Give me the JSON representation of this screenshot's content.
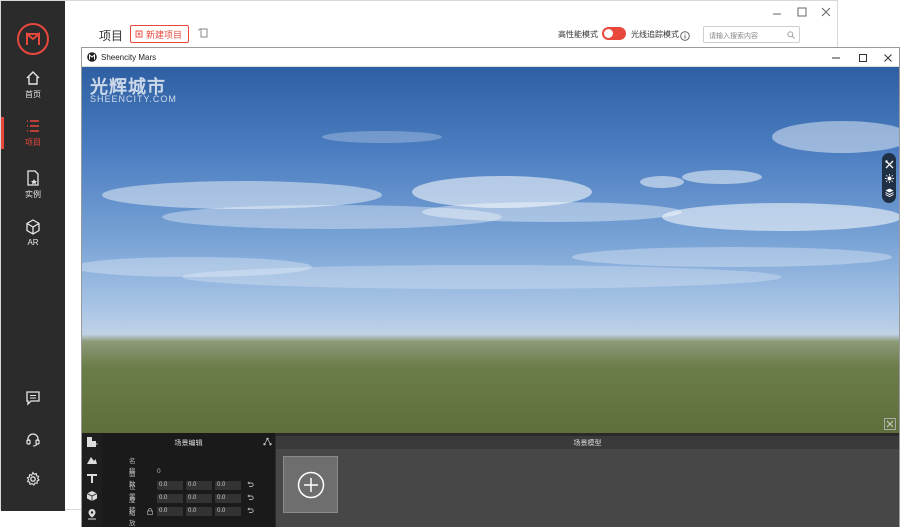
{
  "bg_app": {
    "header_title": "项目",
    "new_project_label": "新建项目",
    "perf_mode_label": "高性能模式",
    "ray_trace_label": "光线追踪模式",
    "search_placeholder": "请输入搜索内容",
    "accent": "#e8473c",
    "sidebar_bg": "#2b2b2b"
  },
  "sidebar": {
    "items": [
      {
        "label": "首页",
        "icon": "home-icon"
      },
      {
        "label": "项目",
        "icon": "list-icon",
        "active": true
      },
      {
        "label": "实例",
        "icon": "document-star-icon"
      },
      {
        "label": "AR",
        "icon": "cube-icon"
      }
    ],
    "bottom_icons": [
      "message-icon",
      "headset-icon",
      "gear-icon"
    ]
  },
  "mars_window": {
    "title": "Sheencity Mars",
    "watermark_cn": "光辉城市",
    "watermark_en": "SHEENCITY.COM"
  },
  "scene_editor": {
    "title": "场景编辑",
    "name_label": "名称",
    "faces_label": "面数",
    "faces_value": "0",
    "position_label": "位置",
    "rotation_label": "旋转",
    "scale_label": "缩放",
    "position_values": [
      "0.0",
      "0.0",
      "0.0"
    ],
    "rotation_values": [
      "0.0",
      "0.0",
      "0.0"
    ],
    "scale_values": [
      "0.0",
      "0.0",
      "0.0"
    ]
  },
  "scene_models": {
    "title": "场景模型"
  }
}
